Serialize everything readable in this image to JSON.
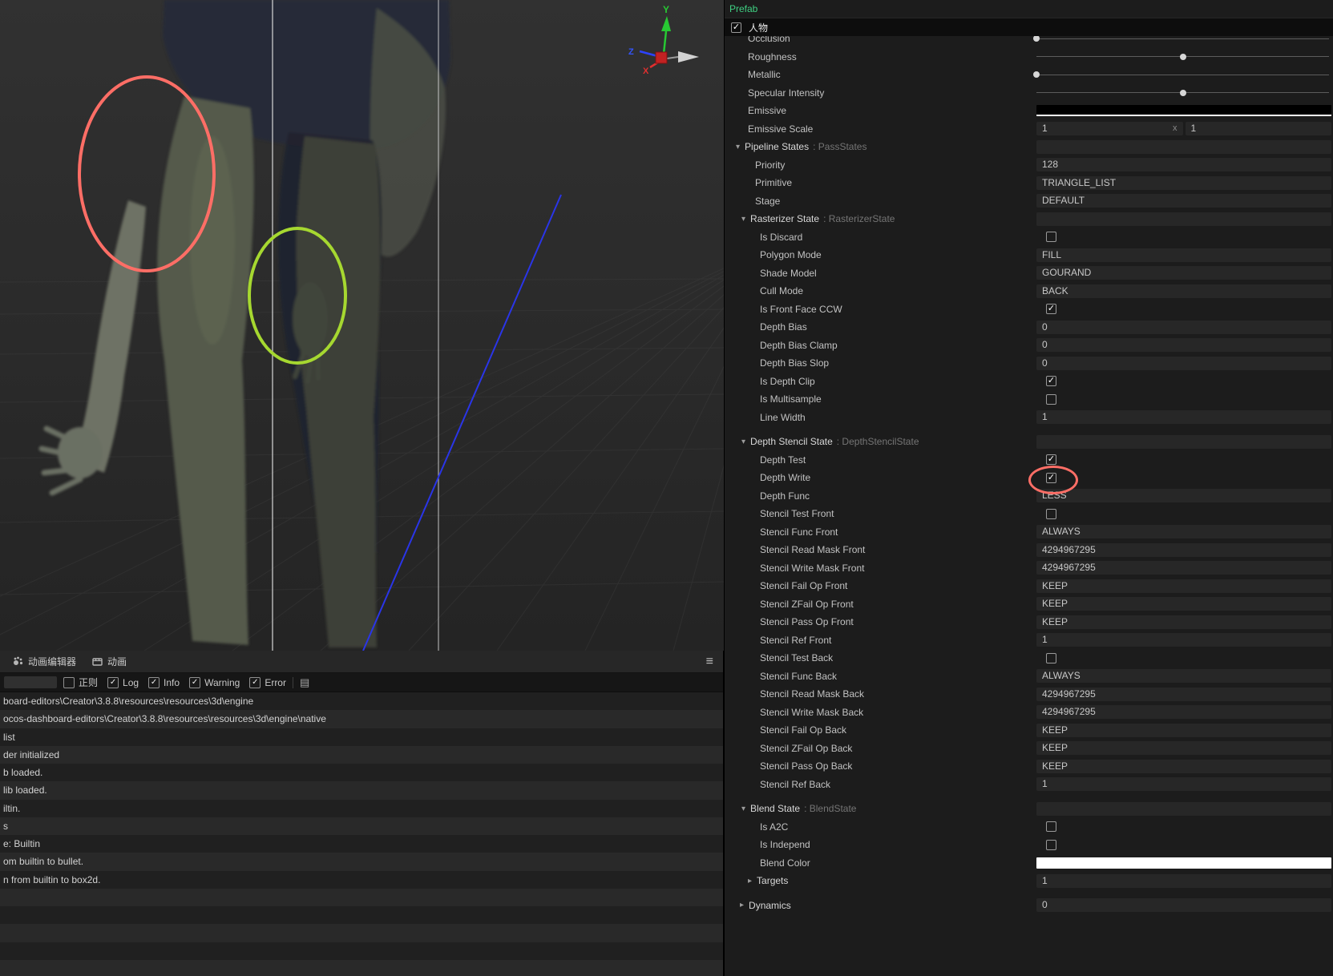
{
  "colors": {
    "accent_green": "#3fd183",
    "annotation_red": "#ff6e66",
    "annotation_green": "#a6d830",
    "blue_line": "#2a35e8"
  },
  "scene": {
    "gizmo": {
      "y_label": "Y",
      "x_label": "X",
      "z_label": "Z"
    }
  },
  "console": {
    "tabs": [
      {
        "label": "动画编辑器"
      },
      {
        "label": "动画"
      }
    ],
    "menu_icon": "≡",
    "doc_icon": "▤",
    "filters": [
      {
        "label": "正则",
        "checked": false
      },
      {
        "label": "Log",
        "checked": true
      },
      {
        "label": "Info",
        "checked": true
      },
      {
        "label": "Warning",
        "checked": true
      },
      {
        "label": "Error",
        "checked": true
      }
    ],
    "log_lines": [
      "board-editors\\Creator\\3.8.8\\resources\\resources\\3d\\engine",
      "ocos-dashboard-editors\\Creator\\3.8.8\\resources\\resources\\3d\\engine\\native",
      "list",
      "der initialized",
      "b loaded.",
      "lib loaded.",
      "iltin.",
      "s",
      "e: Builtin",
      "om builtin to bullet.",
      "n from builtin to box2d."
    ]
  },
  "inspector": {
    "prefab_label": "Prefab",
    "node": {
      "label": "人物",
      "checked": true
    },
    "rows": [
      {
        "kind": "slider",
        "label": "Occlusion",
        "pos": 0,
        "indent": 29
      },
      {
        "kind": "slider",
        "label": "Roughness",
        "pos": 0.5,
        "indent": 29
      },
      {
        "kind": "slider",
        "label": "Metallic",
        "pos": 0,
        "indent": 29
      },
      {
        "kind": "slider",
        "label": "Specular Intensity",
        "pos": 0.5,
        "indent": 29
      },
      {
        "kind": "color",
        "label": "Emissive",
        "color": "#000000",
        "indent": 29
      },
      {
        "kind": "vec",
        "label": "Emissive Scale",
        "v1": "1",
        "suffix": "x",
        "v2": "1",
        "indent": 29
      },
      {
        "kind": "header",
        "label": "Pipeline States",
        "type_suffix": ": PassStates",
        "indent": 14
      },
      {
        "kind": "input",
        "label": "Priority",
        "value": "128",
        "indent": 38
      },
      {
        "kind": "input",
        "label": "Primitive",
        "value": "TRIANGLE_LIST",
        "indent": 38
      },
      {
        "kind": "input",
        "label": "Stage",
        "value": "DEFAULT",
        "indent": 38
      },
      {
        "kind": "header",
        "label": "Rasterizer State",
        "type_suffix": ": RasterizerState",
        "indent": 21
      },
      {
        "kind": "checkbox",
        "label": "Is Discard",
        "checked": false,
        "indent": 44
      },
      {
        "kind": "input",
        "label": "Polygon Mode",
        "value": "FILL",
        "indent": 44
      },
      {
        "kind": "input",
        "label": "Shade Model",
        "value": "GOURAND",
        "indent": 44
      },
      {
        "kind": "input",
        "label": "Cull Mode",
        "value": "BACK",
        "indent": 44
      },
      {
        "kind": "checkbox",
        "label": "Is Front Face CCW",
        "checked": true,
        "indent": 44
      },
      {
        "kind": "input",
        "label": "Depth Bias",
        "value": "0",
        "indent": 44
      },
      {
        "kind": "input",
        "label": "Depth Bias Clamp",
        "value": "0",
        "indent": 44
      },
      {
        "kind": "input",
        "label": "Depth Bias Slop",
        "value": "0",
        "indent": 44
      },
      {
        "kind": "checkbox",
        "label": "Is Depth Clip",
        "checked": true,
        "indent": 44
      },
      {
        "kind": "checkbox",
        "label": "Is Multisample",
        "checked": false,
        "indent": 44
      },
      {
        "kind": "input",
        "label": "Line Width",
        "value": "1",
        "indent": 44
      },
      {
        "kind": "header",
        "label": "Depth Stencil State",
        "type_suffix": ": DepthStencilState",
        "indent": 21,
        "gap": true
      },
      {
        "kind": "checkbox",
        "label": "Depth Test",
        "checked": true,
        "indent": 44
      },
      {
        "kind": "checkbox",
        "label": "Depth Write",
        "checked": true,
        "indent": 44,
        "annotated": true
      },
      {
        "kind": "input",
        "label": "Depth Func",
        "value": "LESS",
        "indent": 44
      },
      {
        "kind": "checkbox",
        "label": "Stencil Test Front",
        "checked": false,
        "indent": 44
      },
      {
        "kind": "input",
        "label": "Stencil Func Front",
        "value": "ALWAYS",
        "indent": 44
      },
      {
        "kind": "input",
        "label": "Stencil Read Mask Front",
        "value": "4294967295",
        "indent": 44
      },
      {
        "kind": "input",
        "label": "Stencil Write Mask Front",
        "value": "4294967295",
        "indent": 44
      },
      {
        "kind": "input",
        "label": "Stencil Fail Op Front",
        "value": "KEEP",
        "indent": 44
      },
      {
        "kind": "input",
        "label": "Stencil ZFail Op Front",
        "value": "KEEP",
        "indent": 44
      },
      {
        "kind": "input",
        "label": "Stencil Pass Op Front",
        "value": "KEEP",
        "indent": 44
      },
      {
        "kind": "input",
        "label": "Stencil Ref Front",
        "value": "1",
        "indent": 44
      },
      {
        "kind": "checkbox",
        "label": "Stencil Test Back",
        "checked": false,
        "indent": 44
      },
      {
        "kind": "input",
        "label": "Stencil Func Back",
        "value": "ALWAYS",
        "indent": 44
      },
      {
        "kind": "input",
        "label": "Stencil Read Mask Back",
        "value": "4294967295",
        "indent": 44
      },
      {
        "kind": "input",
        "label": "Stencil Write Mask Back",
        "value": "4294967295",
        "indent": 44
      },
      {
        "kind": "input",
        "label": "Stencil Fail Op Back",
        "value": "KEEP",
        "indent": 44
      },
      {
        "kind": "input",
        "label": "Stencil ZFail Op Back",
        "value": "KEEP",
        "indent": 44
      },
      {
        "kind": "input",
        "label": "Stencil Pass Op Back",
        "value": "KEEP",
        "indent": 44
      },
      {
        "kind": "input",
        "label": "Stencil Ref Back",
        "value": "1",
        "indent": 44
      },
      {
        "kind": "header",
        "label": "Blend State",
        "type_suffix": ": BlendState",
        "indent": 21,
        "gap": true
      },
      {
        "kind": "checkbox",
        "label": "Is A2C",
        "checked": false,
        "indent": 44
      },
      {
        "kind": "checkbox",
        "label": "Is Independ",
        "checked": false,
        "indent": 44
      },
      {
        "kind": "color",
        "label": "Blend Color",
        "color": "#ffffff",
        "indent": 44
      },
      {
        "kind": "collapsed",
        "label": "Targets",
        "value": "1",
        "indent": 29
      },
      {
        "kind": "collapsed",
        "label": "Dynamics",
        "value": "0",
        "indent": 19,
        "gap": true
      }
    ]
  }
}
